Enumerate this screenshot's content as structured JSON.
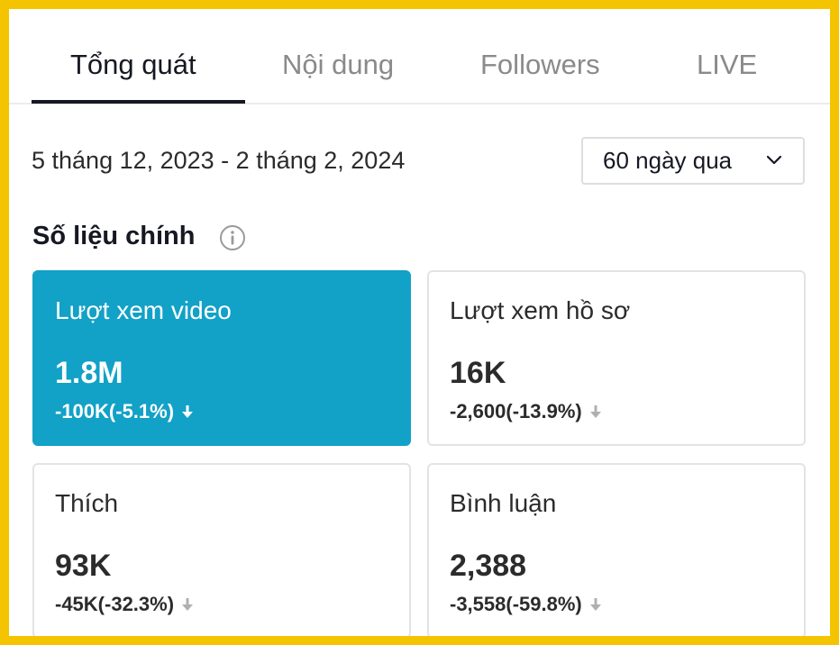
{
  "tabs": [
    {
      "label": "Tổng quát",
      "active": true
    },
    {
      "label": "Nội dung",
      "active": false
    },
    {
      "label": "Followers",
      "active": false
    },
    {
      "label": "LIVE",
      "active": false
    }
  ],
  "date_range": "5 tháng 12, 2023 - 2 tháng 2, 2024",
  "period_select": {
    "value": "60 ngày qua",
    "icon": "chevron-down-icon"
  },
  "section": {
    "title": "Số liệu chính",
    "icon": "info-icon"
  },
  "metrics": [
    {
      "label": "Lượt xem video",
      "value": "1.8M",
      "change": "-100K(-5.1%)",
      "active": true
    },
    {
      "label": "Lượt xem hồ sơ",
      "value": "16K",
      "change": "-2,600(-13.9%)",
      "active": false
    },
    {
      "label": "Thích",
      "value": "93K",
      "change": "-45K(-32.3%)",
      "active": false
    },
    {
      "label": "Bình luận",
      "value": "2,388",
      "change": "-3,558(-59.8%)",
      "active": false
    }
  ],
  "colors": {
    "frame_border": "#f5c400",
    "active_card": "#12a1c7",
    "text_primary": "#161823",
    "text_muted": "#8a8a8a",
    "arrow_muted": "#b0b0b0"
  }
}
